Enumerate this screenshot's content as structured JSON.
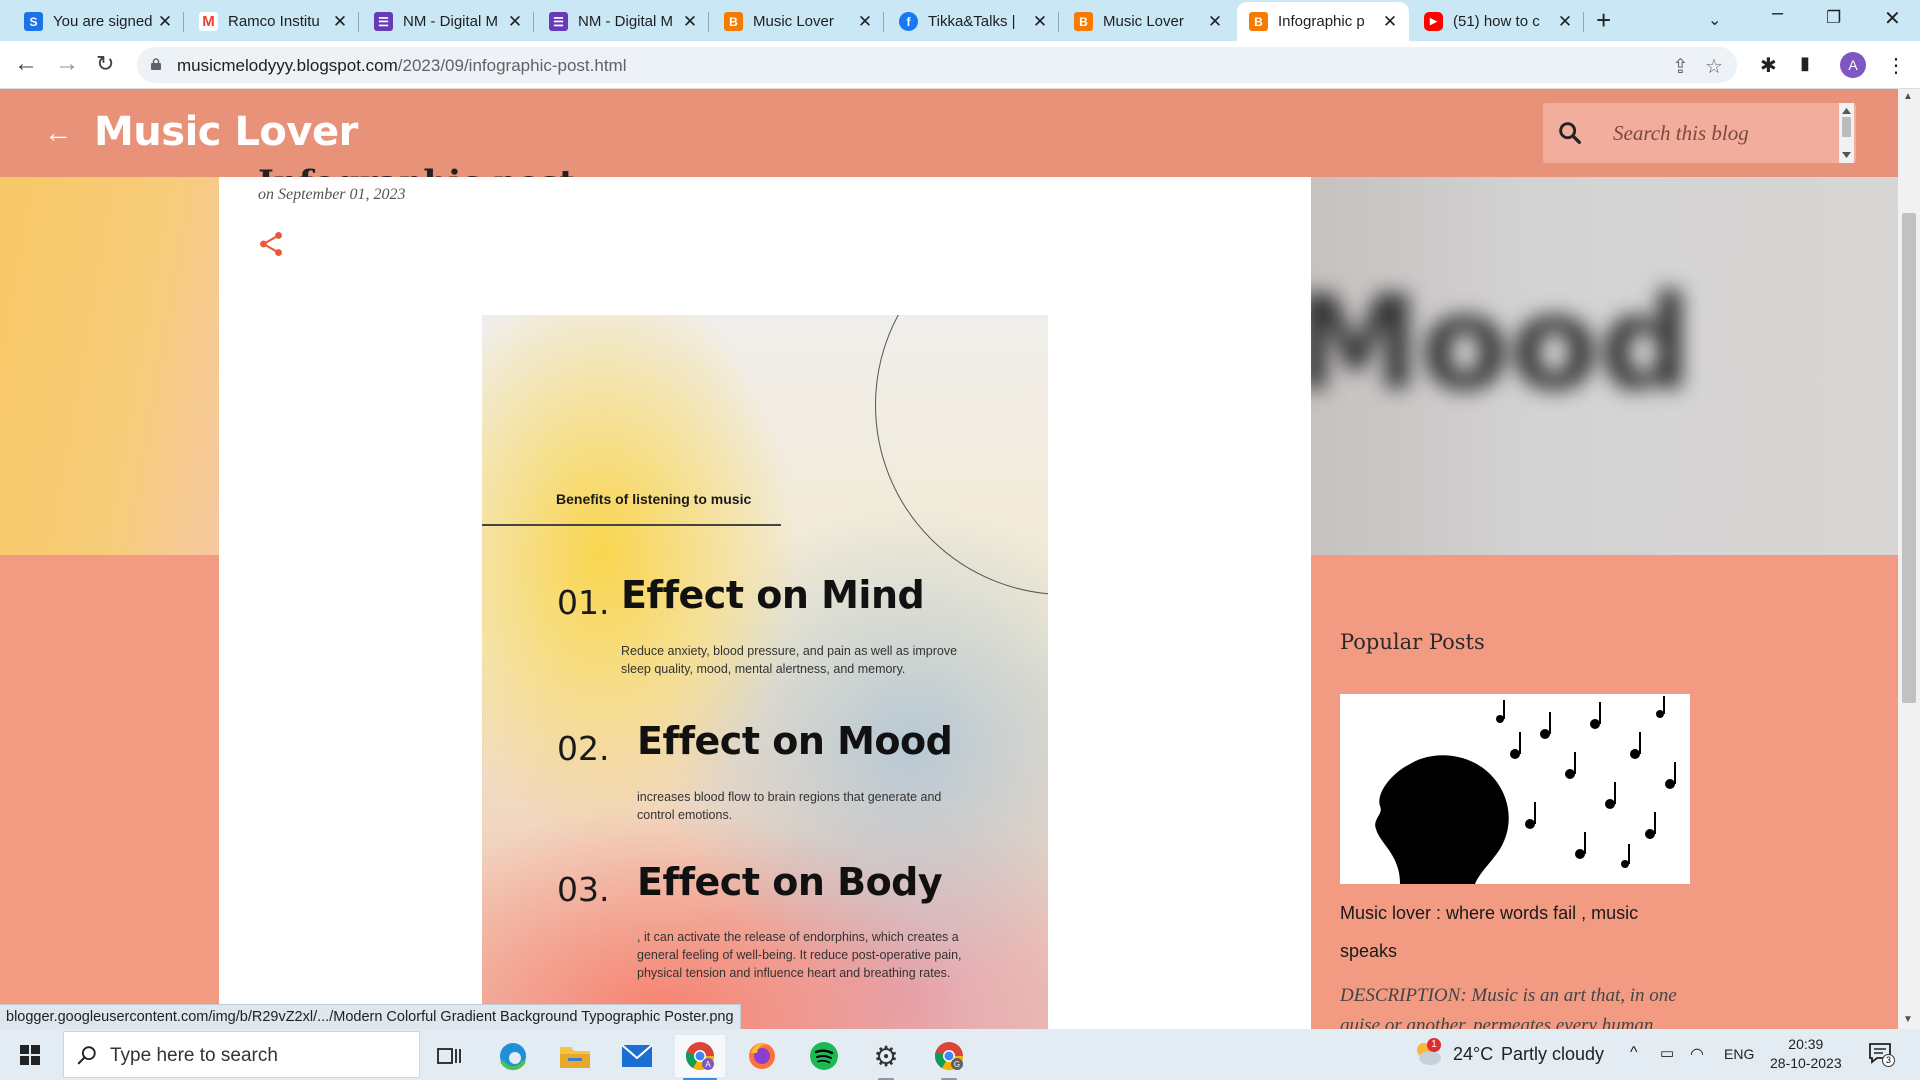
{
  "browser": {
    "tabs": [
      {
        "title": "You are signed",
        "favicon": "simplenote-icon",
        "color": "#1a73e8"
      },
      {
        "title": "Ramco Institu",
        "favicon": "gmail-icon",
        "color": "#ea4335"
      },
      {
        "title": "NM - Digital M",
        "favicon": "forms-icon",
        "color": "#673ab7"
      },
      {
        "title": "NM - Digital M",
        "favicon": "forms-icon",
        "color": "#673ab7"
      },
      {
        "title": "Music Lover",
        "favicon": "blogger-icon",
        "color": "#f57c00"
      },
      {
        "title": "Tikka&Talks |",
        "favicon": "facebook-icon",
        "color": "#1877f2"
      },
      {
        "title": "Music Lover",
        "favicon": "blogger-icon",
        "color": "#f57c00"
      },
      {
        "title": "Infographic p",
        "favicon": "blogger-icon",
        "color": "#f57c00"
      },
      {
        "title": "(51) how to c",
        "favicon": "youtube-icon",
        "color": "#ff0000"
      }
    ],
    "active_tab": 7,
    "url_host": "musicmelodyyy.blogspot.com",
    "url_path": "/2023/09/infographic-post.html",
    "profile_initial": "A"
  },
  "blog": {
    "title": "Music Lover",
    "search_placeholder": "Search this blog",
    "post_date": "on September 01, 2023",
    "post_title_partial": "Infographic post",
    "blurred_word": "Mood"
  },
  "infographic": {
    "heading": "Benefits of listening to music",
    "items": [
      {
        "num": "01.",
        "title": "Effect on Mind",
        "text": "Reduce anxiety, blood pressure, and pain as well as improve sleep quality, mood, mental alertness, and memory."
      },
      {
        "num": "02.",
        "title": "Effect on Mood",
        "text": " increases blood flow to brain regions that generate and control emotions."
      },
      {
        "num": "03.",
        "title": "Effect on Body",
        "text": ", it can activate the release of endorphins, which creates a general feeling of well-being. It reduce post-operative pain, physical tension and influence heart and breathing rates."
      }
    ]
  },
  "sidebar": {
    "popular_heading": "Popular Posts",
    "post_title": "Music lover : where words fail , music speaks",
    "post_desc": "  DESCRIPTION: Music is an art that, in one guise or another, permeates every human"
  },
  "status_url": "blogger.googleusercontent.com/img/b/R29vZ2xl/.../Modern Colorful Gradient Background Typographic Poster.png",
  "taskbar": {
    "search_placeholder": "Type here to search",
    "weather_temp": "24°C",
    "weather_text": "Partly cloudy",
    "weather_badge": "1",
    "lang": "ENG",
    "time": "20:39",
    "date": "28-10-2023",
    "notif_count": "3"
  },
  "colors": {
    "header": "#e8927a",
    "page_bg": "#f29b82",
    "accent": "#e8593a"
  }
}
